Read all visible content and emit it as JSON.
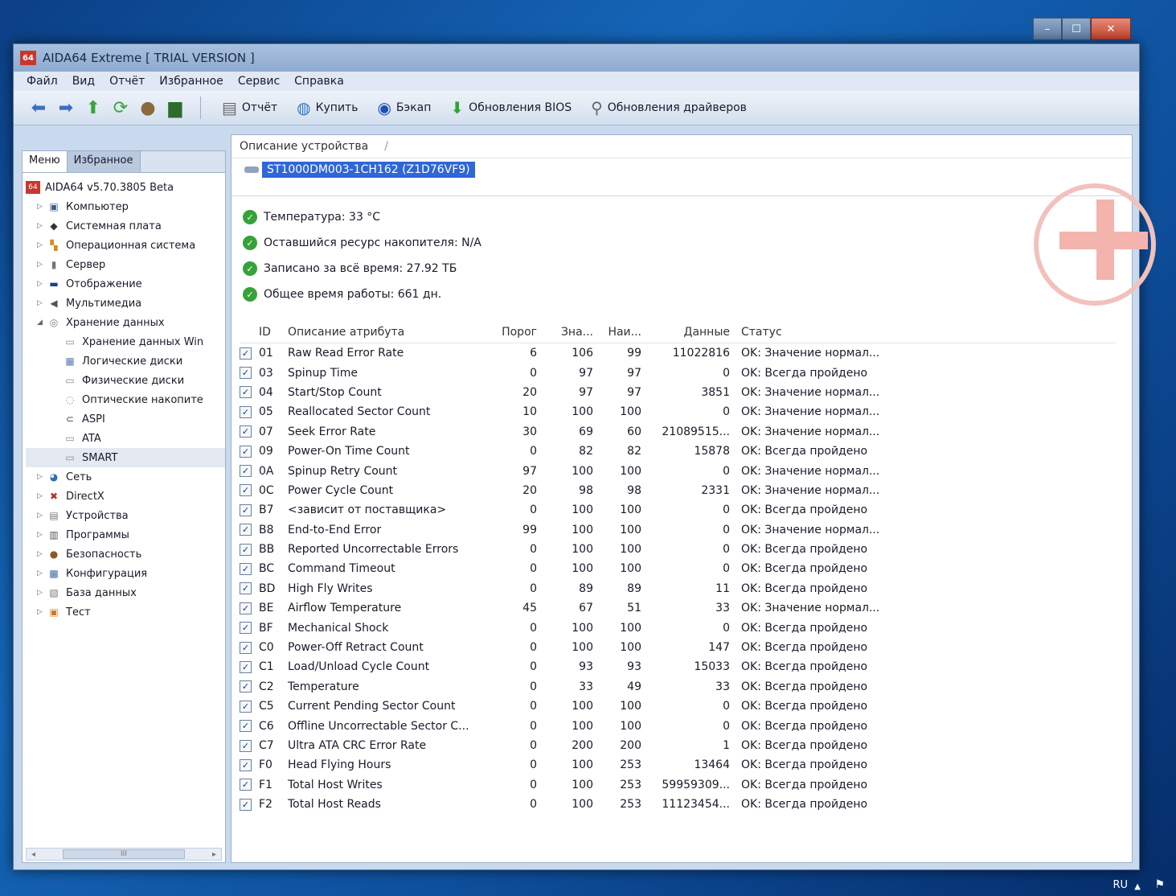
{
  "window": {
    "title": "AIDA64 Extreme  [ TRIAL VERSION ]",
    "app_icon_label": "64",
    "caption": {
      "minimize": "–",
      "maximize": "☐",
      "close": "✕"
    }
  },
  "menu": [
    "Файл",
    "Вид",
    "Отчёт",
    "Избранное",
    "Сервис",
    "Справка"
  ],
  "toolbar": {
    "buttons": [
      {
        "label": "Отчёт",
        "icon": "report-icon"
      },
      {
        "label": "Купить",
        "icon": "globe-icon"
      },
      {
        "label": "Бэкап",
        "icon": "backup-icon"
      },
      {
        "label": "Обновления BIOS",
        "icon": "download-arrow-icon"
      },
      {
        "label": "Обновления драйверов",
        "icon": "magnifier-icon"
      }
    ]
  },
  "left": {
    "tabs": [
      "Меню",
      "Избранное"
    ],
    "tree": [
      {
        "label": "AIDA64 v5.70.3805 Beta",
        "level": 0,
        "icon": "aida64-icon"
      },
      {
        "label": "Компьютер",
        "level": 1,
        "icon": "computer-icon"
      },
      {
        "label": "Системная плата",
        "level": 1,
        "icon": "motherboard-icon"
      },
      {
        "label": "Операционная система",
        "level": 1,
        "icon": "windows-icon"
      },
      {
        "label": "Сервер",
        "level": 1,
        "icon": "server-icon"
      },
      {
        "label": "Отображение",
        "level": 1,
        "icon": "display-icon"
      },
      {
        "label": "Мультимедиа",
        "level": 1,
        "icon": "speaker-icon"
      },
      {
        "label": "Хранение данных",
        "level": 1,
        "icon": "storage-icon",
        "expanded": true
      },
      {
        "label": "Хранение данных Win",
        "level": 2,
        "icon": "drive-icon"
      },
      {
        "label": "Логические диски",
        "level": 2,
        "icon": "logical-disk-icon"
      },
      {
        "label": "Физические диски",
        "level": 2,
        "icon": "physical-disk-icon"
      },
      {
        "label": "Оптические накопите",
        "level": 2,
        "icon": "optical-drive-icon"
      },
      {
        "label": "ASPI",
        "level": 2,
        "icon": "aspi-icon"
      },
      {
        "label": "ATA",
        "level": 2,
        "icon": "ata-icon"
      },
      {
        "label": "SMART",
        "level": 2,
        "icon": "smart-icon"
      },
      {
        "label": "Сеть",
        "level": 1,
        "icon": "network-icon"
      },
      {
        "label": "DirectX",
        "level": 1,
        "icon": "directx-icon"
      },
      {
        "label": "Устройства",
        "level": 1,
        "icon": "devices-icon"
      },
      {
        "label": "Программы",
        "level": 1,
        "icon": "programs-icon"
      },
      {
        "label": "Безопасность",
        "level": 1,
        "icon": "security-icon"
      },
      {
        "label": "Конфигурация",
        "level": 1,
        "icon": "config-icon"
      },
      {
        "label": "База данных",
        "level": 1,
        "icon": "database-icon"
      },
      {
        "label": "Тест",
        "level": 1,
        "icon": "test-icon"
      }
    ],
    "scroll_label": "III"
  },
  "device": {
    "header": "Описание устройства",
    "header_sort": "/",
    "selected": "ST1000DM003-1CH162 (Z1D76VF9)"
  },
  "summary": [
    "Температура: 33 °C",
    "Оставшийся ресурс накопителя: N/A",
    "Записано за всё время: 27.92 ТБ",
    "Общее время работы: 661 дн."
  ],
  "table": {
    "headers": {
      "id": "ID",
      "desc": "Описание атрибута",
      "threshold": "Порог",
      "value": "Зна...",
      "worst": "Наи...",
      "data": "Данные",
      "status": "Статус"
    },
    "rows": [
      [
        "01",
        "Raw Read Error Rate",
        "6",
        "106",
        "99",
        "11022816",
        "OK: Значение нормал..."
      ],
      [
        "03",
        "Spinup Time",
        "0",
        "97",
        "97",
        "0",
        "OK: Всегда пройдено"
      ],
      [
        "04",
        "Start/Stop Count",
        "20",
        "97",
        "97",
        "3851",
        "OK: Значение нормал..."
      ],
      [
        "05",
        "Reallocated Sector Count",
        "10",
        "100",
        "100",
        "0",
        "OK: Значение нормал..."
      ],
      [
        "07",
        "Seek Error Rate",
        "30",
        "69",
        "60",
        "21089515...",
        "OK: Значение нормал..."
      ],
      [
        "09",
        "Power-On Time Count",
        "0",
        "82",
        "82",
        "15878",
        "OK: Всегда пройдено"
      ],
      [
        "0A",
        "Spinup Retry Count",
        "97",
        "100",
        "100",
        "0",
        "OK: Значение нормал..."
      ],
      [
        "0C",
        "Power Cycle Count",
        "20",
        "98",
        "98",
        "2331",
        "OK: Значение нормал..."
      ],
      [
        "B7",
        "<зависит от поставщика>",
        "0",
        "100",
        "100",
        "0",
        "OK: Всегда пройдено"
      ],
      [
        "B8",
        "End-to-End Error",
        "99",
        "100",
        "100",
        "0",
        "OK: Значение нормал..."
      ],
      [
        "BB",
        "Reported Uncorrectable Errors",
        "0",
        "100",
        "100",
        "0",
        "OK: Всегда пройдено"
      ],
      [
        "BC",
        "Command Timeout",
        "0",
        "100",
        "100",
        "0",
        "OK: Всегда пройдено"
      ],
      [
        "BD",
        "High Fly Writes",
        "0",
        "89",
        "89",
        "11",
        "OK: Всегда пройдено"
      ],
      [
        "BE",
        "Airflow Temperature",
        "45",
        "67",
        "51",
        "33",
        "OK: Значение нормал..."
      ],
      [
        "BF",
        "Mechanical Shock",
        "0",
        "100",
        "100",
        "0",
        "OK: Всегда пройдено"
      ],
      [
        "C0",
        "Power-Off Retract Count",
        "0",
        "100",
        "100",
        "147",
        "OK: Всегда пройдено"
      ],
      [
        "C1",
        "Load/Unload Cycle Count",
        "0",
        "93",
        "93",
        "15033",
        "OK: Всегда пройдено"
      ],
      [
        "C2",
        "Temperature",
        "0",
        "33",
        "49",
        "33",
        "OK: Всегда пройдено"
      ],
      [
        "C5",
        "Current Pending Sector Count",
        "0",
        "100",
        "100",
        "0",
        "OK: Всегда пройдено"
      ],
      [
        "C6",
        "Offline Uncorrectable Sector C...",
        "0",
        "100",
        "100",
        "0",
        "OK: Всегда пройдено"
      ],
      [
        "C7",
        "Ultra ATA CRC Error Rate",
        "0",
        "200",
        "200",
        "1",
        "OK: Всегда пройдено"
      ],
      [
        "F0",
        "Head Flying Hours",
        "0",
        "100",
        "253",
        "13464",
        "OK: Всегда пройдено"
      ],
      [
        "F1",
        "Total Host Writes",
        "0",
        "100",
        "253",
        "59959309...",
        "OK: Всегда пройдено"
      ],
      [
        "F2",
        "Total Host Reads",
        "0",
        "100",
        "253",
        "11123454...",
        "OK: Всегда пройдено"
      ]
    ]
  },
  "taskbar": {
    "lang": "RU"
  },
  "colors": {
    "selection": "#2f66d8",
    "ok": "#36a23a",
    "desktop": "#1566b8"
  }
}
